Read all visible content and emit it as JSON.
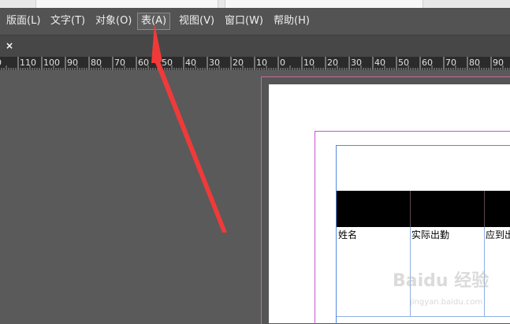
{
  "menubar": {
    "items": [
      {
        "label": "版面(L)"
      },
      {
        "label": "文字(T)"
      },
      {
        "label": "对象(O)"
      },
      {
        "label": "表(A)"
      },
      {
        "label": "视图(V)"
      },
      {
        "label": "窗口(W)"
      },
      {
        "label": "帮助(H)"
      }
    ]
  },
  "tab": {
    "close_symbol": "×"
  },
  "ruler": {
    "labels": [
      "0",
      "110",
      "100",
      "90",
      "80",
      "70",
      "60",
      "50",
      "40",
      "30",
      "20",
      "10",
      "0",
      "10",
      "20",
      "30",
      "40",
      "50",
      "60",
      "70",
      "80",
      "90"
    ]
  },
  "table": {
    "cells": [
      "姓名",
      "实际出勤",
      "应到出"
    ]
  },
  "watermark": {
    "text": "Baidu 经验",
    "sub": "jingyan.baidu.com"
  },
  "colors": {
    "arrow": "#f03a3a",
    "header_fill": "#000000",
    "guide": "#cc55cc",
    "frame": "#5588dd"
  }
}
